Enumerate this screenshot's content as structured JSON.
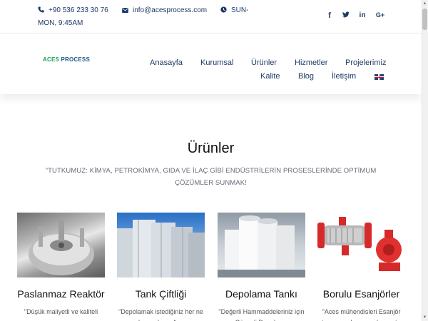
{
  "topbar": {
    "phone": "+90 536 233 30 76",
    "email": "info@acesprocess.com",
    "hours_line1": "SUN-",
    "hours_line2": "MON, 9:45AM",
    "icons": {
      "phone": "phone-icon",
      "email": "envelope-icon",
      "hours": "clock-icon"
    },
    "social": [
      {
        "name": "facebook-icon",
        "glyph": "f"
      },
      {
        "name": "twitter-icon",
        "glyph": "🐦"
      },
      {
        "name": "linkedin-icon",
        "glyph": "in"
      },
      {
        "name": "google-plus-icon",
        "glyph": "G+"
      }
    ]
  },
  "header": {
    "logo": {
      "part1": "ACES",
      "part2": " PROCESS"
    },
    "nav": [
      {
        "label": "Anasayfa"
      },
      {
        "label": "Kurumsal"
      },
      {
        "label": "Ürünler"
      },
      {
        "label": "Hizmetler"
      },
      {
        "label": "Projelerimiz"
      },
      {
        "label": "Kalite"
      },
      {
        "label": "Blog"
      },
      {
        "label": "İletişim"
      }
    ],
    "language_flag": "uk-flag-icon"
  },
  "section": {
    "title": "Ürünler",
    "subtitle": "\"TUTKUMUZ: KİMYA, PETROKİMYA, GIDA VE İLAÇ GİBİ ENDÜSTRİLERİN PROSESLERİNDE OPTİMUM ÇÖZÜMLER SUNMAK!"
  },
  "products": [
    {
      "title": "Paslanmaz Reaktör",
      "text": "\"Düşük maliyetli ve kaliteli"
    },
    {
      "title": "Tank Çiftliği",
      "text": "\"Depolamak istediğiniz her ne olursa olsun, Aces"
    },
    {
      "title": "Depolama Tankı",
      "text": "\"Değerli Hammaddeleriniz için Güvenli Depolama"
    },
    {
      "title": "Borulu Esanjörler",
      "text": "\"Aces mühendisleri Esanjör tasarımında uzmanlaşmıştır"
    }
  ],
  "colors": {
    "accent": "#1f3a66",
    "logo_green": "#1f9d55",
    "subtitle": "#6a6a7a"
  }
}
